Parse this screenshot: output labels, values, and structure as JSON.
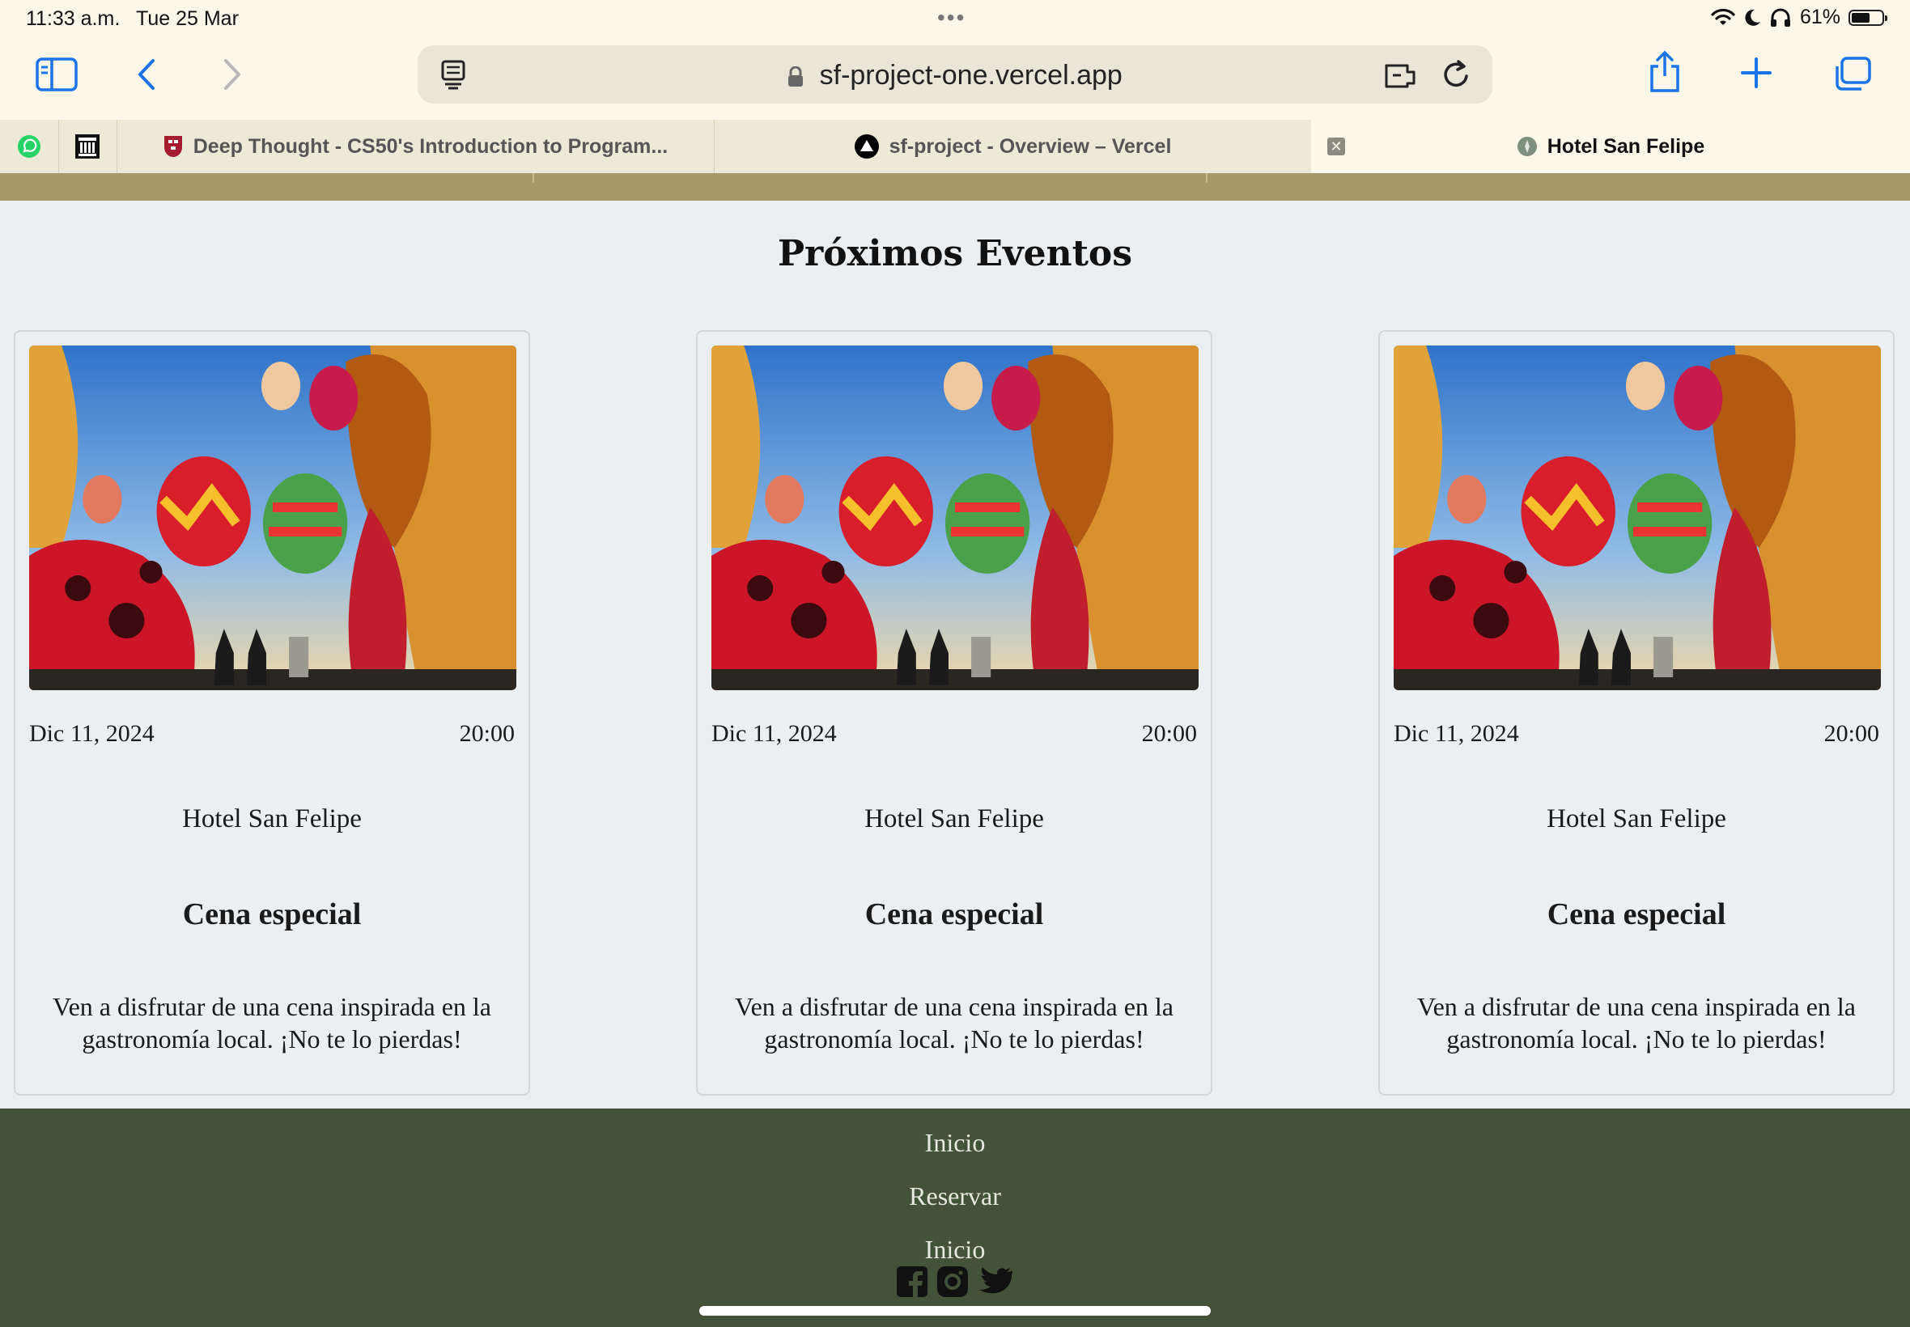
{
  "status_bar": {
    "time": "11:33 a.m.",
    "date": "Tue 25 Mar",
    "battery_percent": "61%",
    "battery_level": 0.61
  },
  "browser": {
    "url": "sf-project-one.vercel.app",
    "tabs": [
      {
        "title": "Deep Thought - CS50's Introduction to Program...",
        "icon": "harvard-shield-icon",
        "active": false
      },
      {
        "title": "sf-project - Overview – Vercel",
        "icon": "vercel-triangle-icon",
        "active": false
      },
      {
        "title": "Hotel San Felipe",
        "icon": "site-favicon-icon",
        "active": true
      }
    ],
    "pinned_tabs": [
      "whatsapp-icon",
      "museum-icon"
    ]
  },
  "page": {
    "section_title": "Próximos Eventos",
    "events": [
      {
        "date": "Dic 11, 2024",
        "time": "20:00",
        "venue": "Hotel San Felipe",
        "title": "Cena especial",
        "description": "Ven a disfrutar de una cena inspirada en la gastronomía local. ¡No te lo pierdas!"
      },
      {
        "date": "Dic 11, 2024",
        "time": "20:00",
        "venue": "Hotel San Felipe",
        "title": "Cena especial",
        "description": "Ven a disfrutar de una cena inspirada en la gastronomía local. ¡No te lo pierdas!"
      },
      {
        "date": "Dic 11, 2024",
        "time": "20:00",
        "venue": "Hotel San Felipe",
        "title": "Cena especial",
        "description": "Ven a disfrutar de una cena inspirada en la gastronomía local. ¡No te lo pierdas!"
      }
    ],
    "footer_links": [
      "Inicio",
      "Reservar",
      "Inicio"
    ],
    "social_icons": [
      "facebook-icon",
      "instagram-icon",
      "twitter-icon"
    ]
  },
  "colors": {
    "accent_blue": "#1a73e8",
    "header_strip": "#a89a68",
    "footer": "#435239",
    "page_background": "#eceff1"
  }
}
